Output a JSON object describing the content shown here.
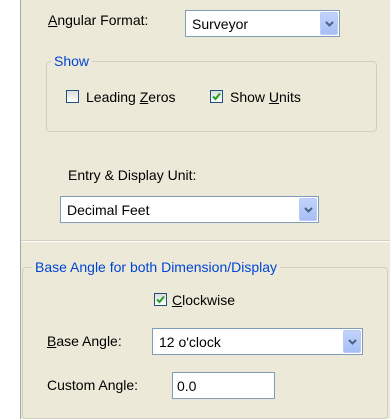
{
  "angular_format": {
    "label_pre": "",
    "label_mnemonic": "A",
    "label_post": "ngular Format:",
    "value": "Surveyor"
  },
  "show_group": {
    "legend": "Show",
    "leading_zeros": {
      "label_pre": "Leading ",
      "label_mnemonic": "Z",
      "label_post": "eros",
      "checked": false
    },
    "show_units": {
      "label_pre": "Show ",
      "label_mnemonic": "U",
      "label_post": "nits",
      "checked": true
    }
  },
  "entry_display_unit": {
    "label": "Entry & Display Unit:",
    "value": "Decimal Feet"
  },
  "base_angle_group": {
    "legend": "Base Angle for both Dimension/Display",
    "clockwise": {
      "label_pre": "",
      "label_mnemonic": "C",
      "label_post": "lockwise",
      "checked": true
    },
    "base_angle": {
      "label_pre": "",
      "label_mnemonic": "B",
      "label_post": "ase Angle:",
      "value": "12 o'clock"
    },
    "custom_angle": {
      "label": "Custom Angle:",
      "value": "0.0"
    }
  },
  "colors": {
    "panel_bg": "#ece9d8",
    "group_legend": "#0046d5",
    "checkmark": "#21a121",
    "combo_arrow": "#4d6185"
  }
}
